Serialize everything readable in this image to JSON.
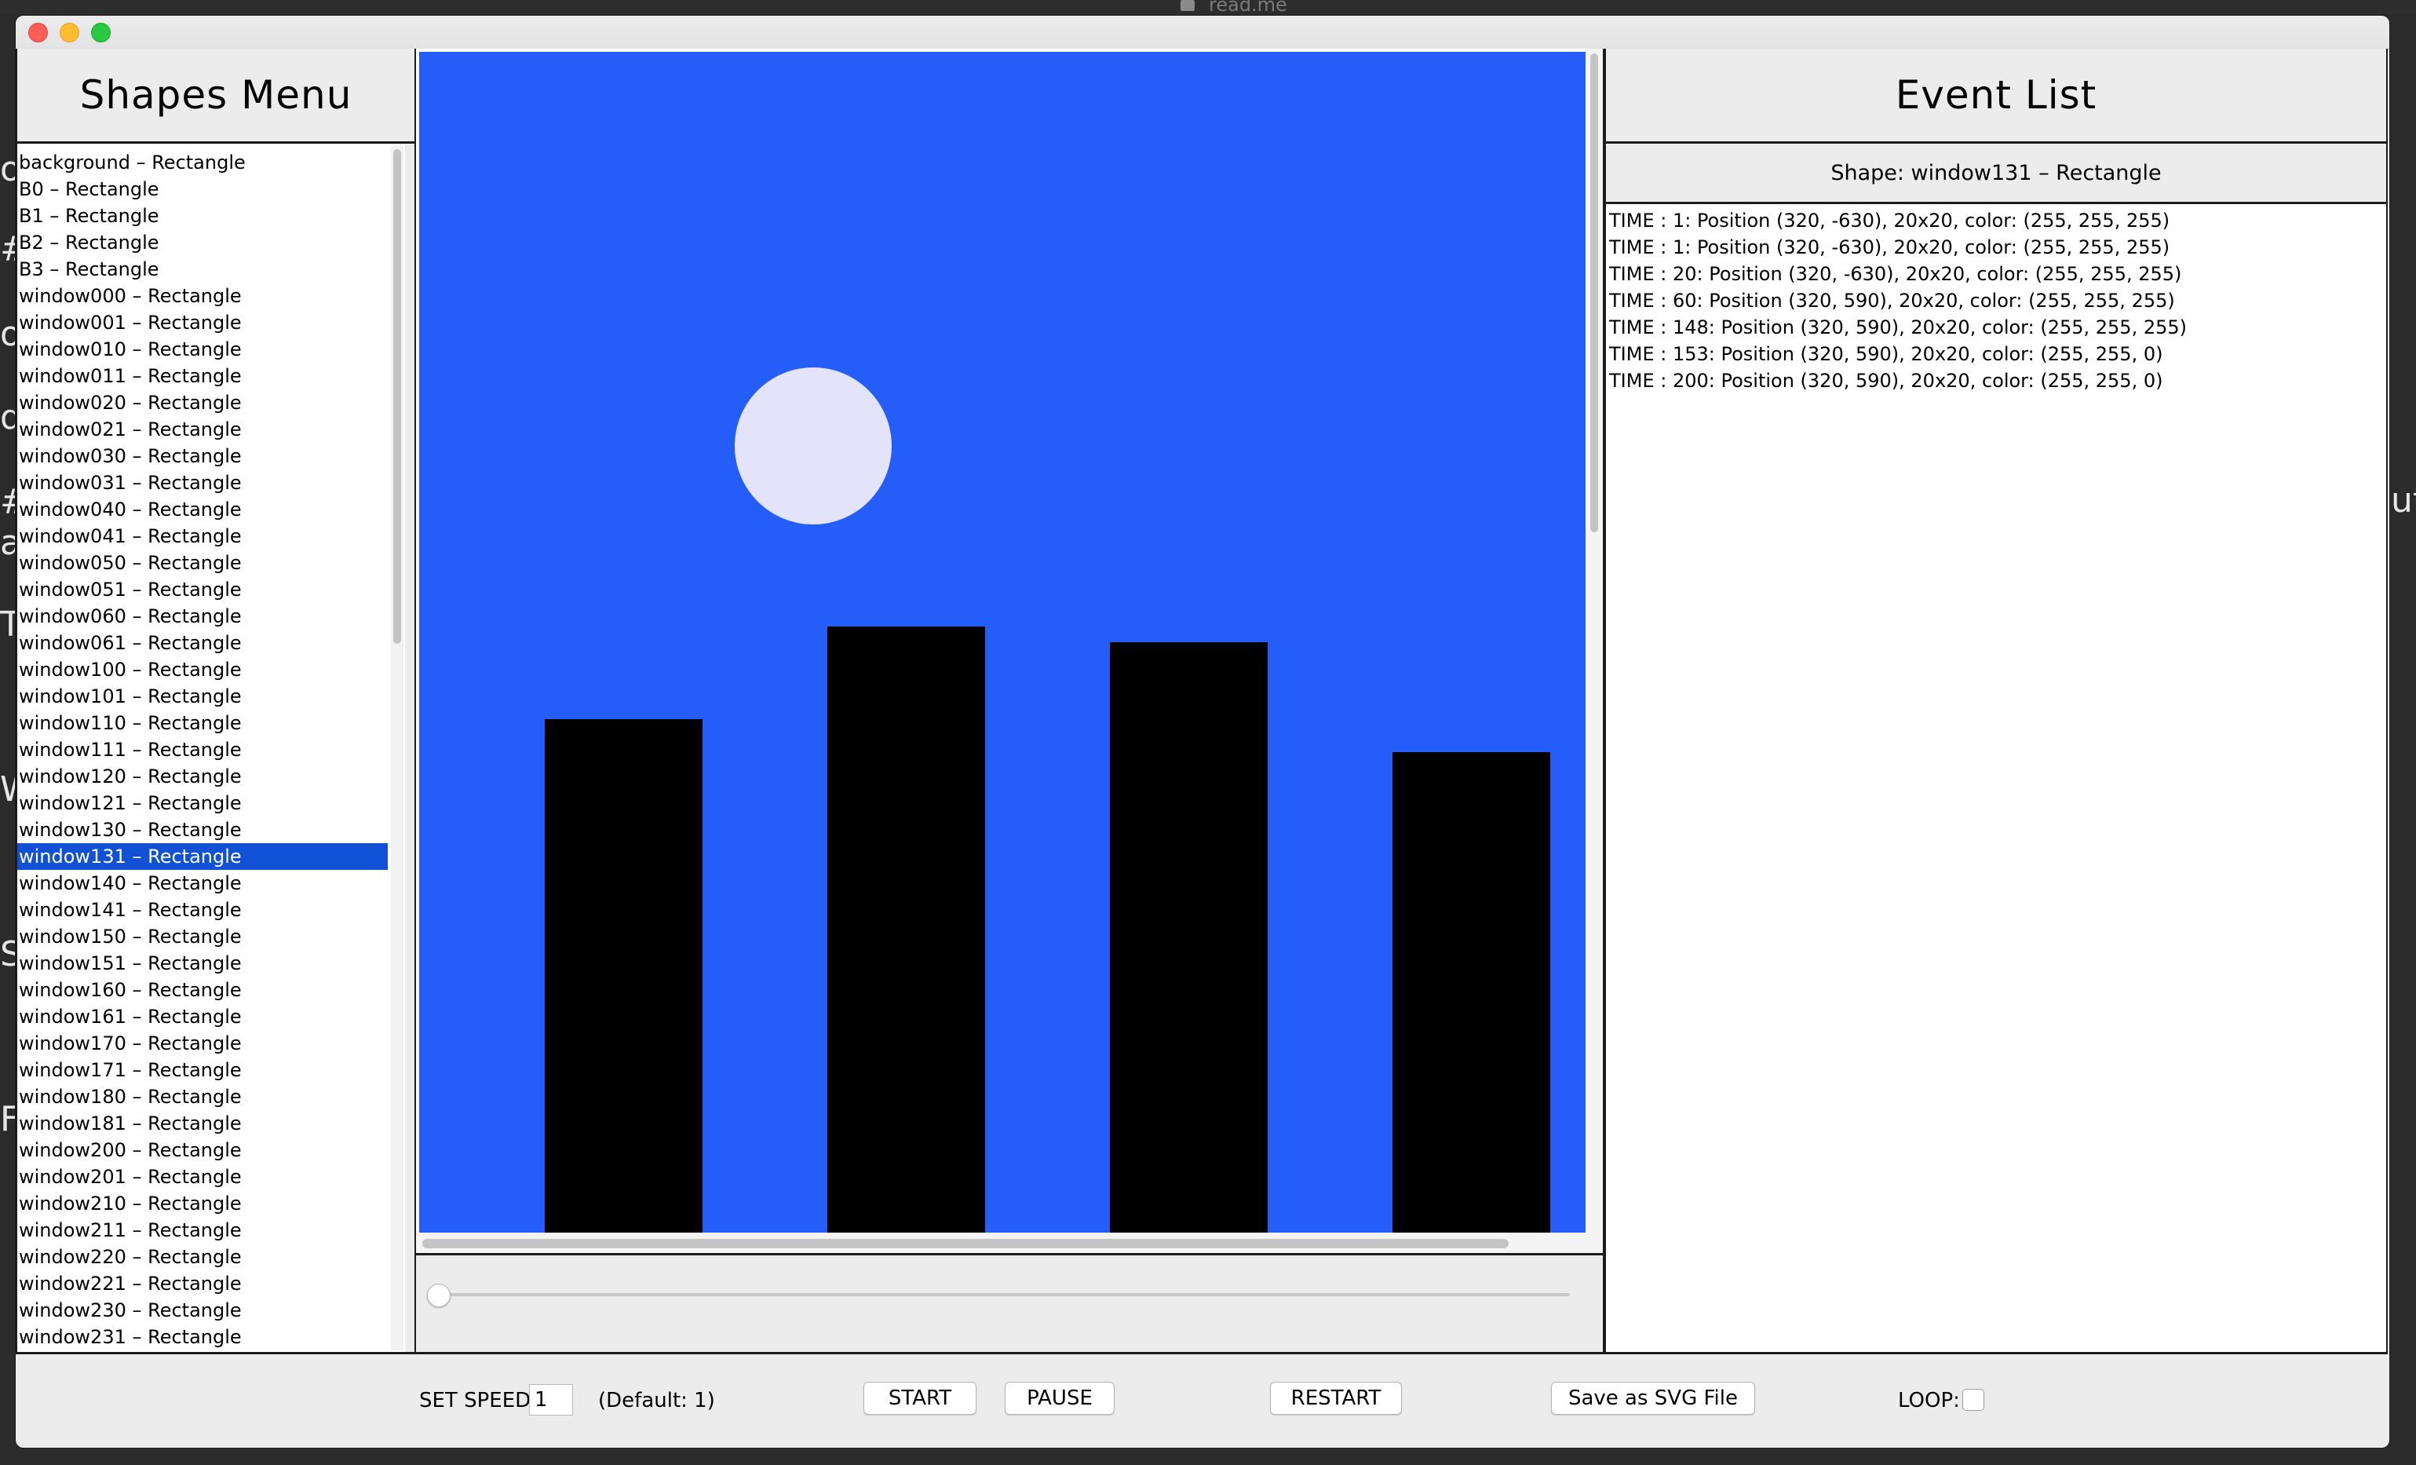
{
  "background": {
    "tab_title": "read.me",
    "fragments": [
      "or",
      "#",
      "or",
      "dc",
      "#",
      "a",
      "T",
      "W",
      "S",
      "F",
      "ut"
    ]
  },
  "shapes_menu": {
    "title": "Shapes Menu",
    "items": [
      "background – Rectangle",
      "B0 – Rectangle",
      "B1 – Rectangle",
      "B2 – Rectangle",
      "B3 – Rectangle",
      "window000 – Rectangle",
      "window001 – Rectangle",
      "window010 – Rectangle",
      "window011 – Rectangle",
      "window020 – Rectangle",
      "window021 – Rectangle",
      "window030 – Rectangle",
      "window031 – Rectangle",
      "window040 – Rectangle",
      "window041 – Rectangle",
      "window050 – Rectangle",
      "window051 – Rectangle",
      "window060 – Rectangle",
      "window061 – Rectangle",
      "window100 – Rectangle",
      "window101 – Rectangle",
      "window110 – Rectangle",
      "window111 – Rectangle",
      "window120 – Rectangle",
      "window121 – Rectangle",
      "window130 – Rectangle",
      "window131 – Rectangle",
      "window140 – Rectangle",
      "window141 – Rectangle",
      "window150 – Rectangle",
      "window151 – Rectangle",
      "window160 – Rectangle",
      "window161 – Rectangle",
      "window170 – Rectangle",
      "window171 – Rectangle",
      "window180 – Rectangle",
      "window181 – Rectangle",
      "window200 – Rectangle",
      "window201 – Rectangle",
      "window210 – Rectangle",
      "window211 – Rectangle",
      "window220 – Rectangle",
      "window221 – Rectangle",
      "window230 – Rectangle",
      "window231 – Rectangle"
    ],
    "selected_index": 26
  },
  "canvas": {
    "background_color": "#245df8",
    "moon_color": "#e3e3fb",
    "building_color": "#000000"
  },
  "event_list": {
    "title": "Event List",
    "shape_label": "Shape: window131 – Rectangle",
    "events": [
      "TIME : 1: Position (320, -630), 20x20, color: (255, 255, 255)",
      "TIME : 1: Position (320, -630), 20x20, color: (255, 255, 255)",
      "TIME : 20: Position (320, -630), 20x20, color: (255, 255, 255)",
      "TIME : 60: Position (320, 590), 20x20, color: (255, 255, 255)",
      "TIME : 148: Position (320, 590), 20x20, color: (255, 255, 255)",
      "TIME : 153: Position (320, 590), 20x20, color: (255, 255, 0)",
      "TIME : 200: Position (320, 590), 20x20, color: (255, 255, 0)"
    ]
  },
  "timeline": {
    "value": 0
  },
  "controls": {
    "speed_label": "SET SPEED:",
    "speed_value": "1",
    "speed_default": "(Default: 1)",
    "start_label": "START",
    "pause_label": "PAUSE",
    "restart_label": "RESTART",
    "save_label": "Save as SVG File",
    "loop_label": "LOOP:",
    "loop_checked": false
  },
  "colors": {
    "selection": "#1051d6",
    "close": "#fe5f57",
    "minimize": "#febc2e",
    "maximize": "#28c840"
  }
}
